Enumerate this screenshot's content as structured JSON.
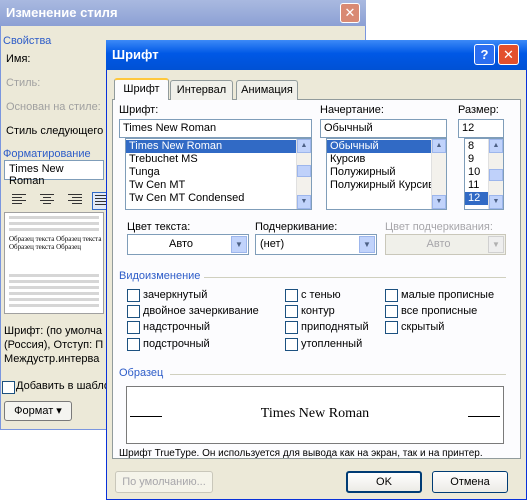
{
  "bg_dialog": {
    "title": "Изменение стиля",
    "close": "✕",
    "properties_header": "Свойства",
    "name_label": "Имя:",
    "style_label": "Стиль:",
    "based_on_label": "Основан на стиле:",
    "next_style_label": "Стиль следующего",
    "formatting_header": "Форматирование",
    "font_value": "Times New Roman",
    "preview_small_text": "Образец  текста  Образец  текста Образец  текста Образец",
    "description": "Шрифт: (по умолча (Россия), Отступ: П Междустр.интерва",
    "add_to_template": "Добавить в шабло",
    "format_button": "Формат"
  },
  "dialog": {
    "title": "Шрифт",
    "help": "?",
    "close": "✕",
    "tabs": [
      "Шрифт",
      "Интервал",
      "Анимация"
    ],
    "font": {
      "label": "Шрифт:",
      "value": "Times New Roman",
      "items": [
        "Times New Roman",
        "Trebuchet MS",
        "Tunga",
        "Tw Cen MT",
        "Tw Cen MT Condensed"
      ],
      "selected_index": 0
    },
    "style": {
      "label": "Начертание:",
      "value": "Обычный",
      "items": [
        "Обычный",
        "Курсив",
        "Полужирный",
        "Полужирный Курсив"
      ],
      "selected_index": 0
    },
    "size": {
      "label": "Размер:",
      "value": "12",
      "items": [
        "8",
        "9",
        "10",
        "11",
        "12"
      ],
      "selected_index": 4
    },
    "text_color": {
      "label": "Цвет текста:",
      "value": "Авто"
    },
    "underline": {
      "label": "Подчеркивание:",
      "value": "(нет)"
    },
    "underline_color": {
      "label": "Цвет подчеркивания:",
      "value": "Авто"
    },
    "effects": {
      "header": "Видоизменение",
      "col1": [
        "зачеркнутый",
        "двойное зачеркивание",
        "надстрочный",
        "подстрочный"
      ],
      "col2": [
        "с тенью",
        "контур",
        "приподнятый",
        "утопленный"
      ],
      "col3": [
        "малые прописные",
        "все прописные",
        "скрытый"
      ]
    },
    "preview": {
      "header": "Образец",
      "text": "Times New Roman"
    },
    "truetype_note": "Шрифт TrueType. Он используется для вывода как на экран, так и на принтер.",
    "default_button": "По умолчанию...",
    "ok_button": "OK",
    "cancel_button": "Отмена"
  }
}
